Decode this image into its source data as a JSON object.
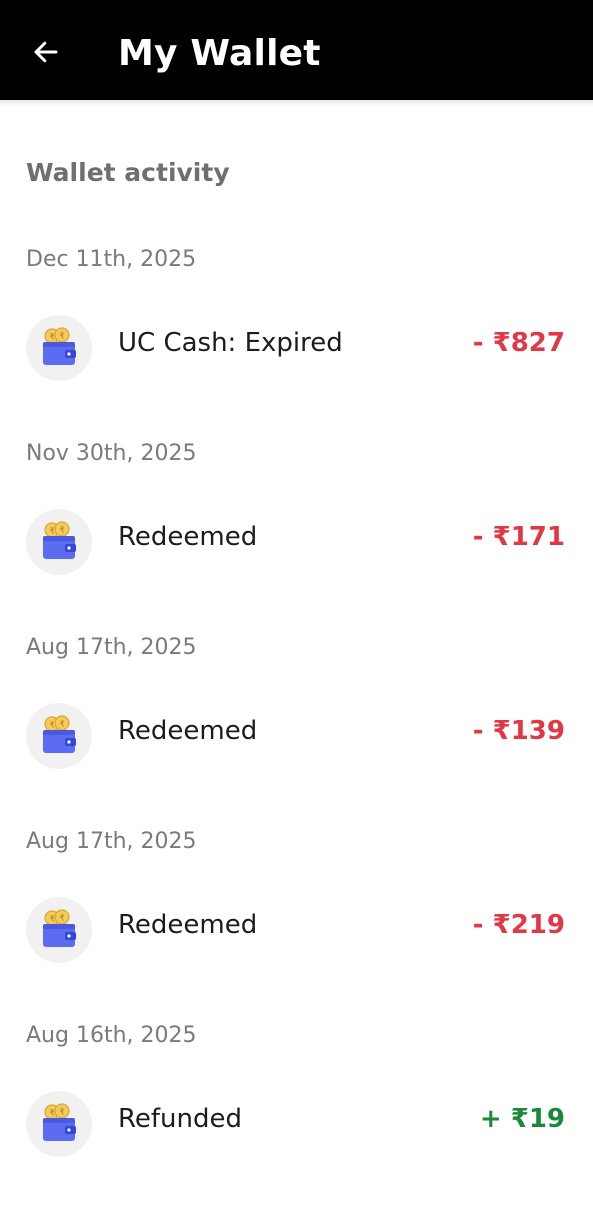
{
  "header": {
    "title": "My Wallet",
    "back_icon": "arrow-left-icon"
  },
  "section": {
    "title": "Wallet activity"
  },
  "colors": {
    "header_bg": "#000000",
    "debit": "#e23744",
    "credit": "#1a8a3a",
    "wallet_icon": "#5b6cf0",
    "coin": "#f4c95d"
  },
  "activities": [
    {
      "date": "Dec 11th, 2025",
      "label": "UC Cash: Expired",
      "amount": "- ₹827",
      "type": "debit",
      "icon": "wallet-coins-icon"
    },
    {
      "date": "Nov 30th, 2025",
      "label": "Redeemed",
      "amount": "- ₹171",
      "type": "debit",
      "icon": "wallet-coins-icon"
    },
    {
      "date": "Aug 17th, 2025",
      "label": "Redeemed",
      "amount": "- ₹139",
      "type": "debit",
      "icon": "wallet-coins-icon"
    },
    {
      "date": "Aug 17th, 2025",
      "label": "Redeemed",
      "amount": "- ₹219",
      "type": "debit",
      "icon": "wallet-coins-icon"
    },
    {
      "date": "Aug 16th, 2025",
      "label": "Refunded",
      "amount": "+ ₹19",
      "type": "credit",
      "icon": "wallet-coins-icon"
    }
  ]
}
